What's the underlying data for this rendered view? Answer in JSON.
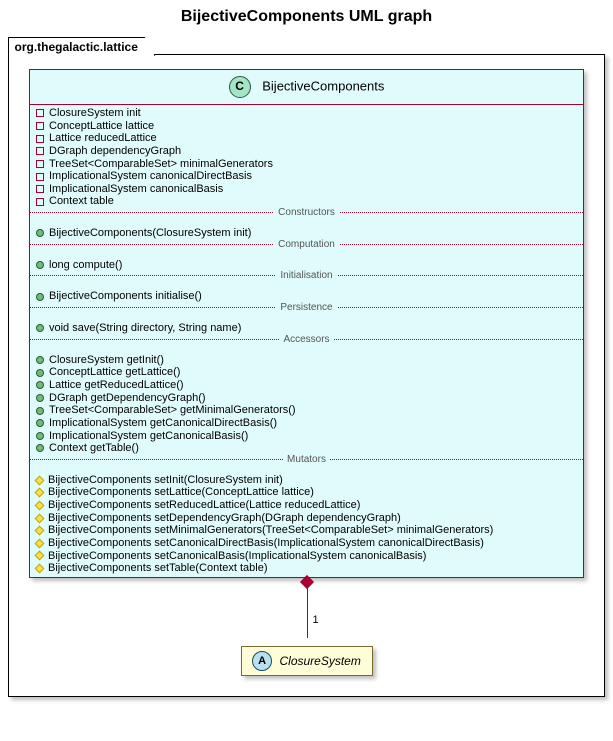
{
  "title": "BijectiveComponents UML graph",
  "package_name": "org.thegalactic.lattice",
  "class": {
    "marker": "C",
    "name": "BijectiveComponents",
    "fields": [
      "ClosureSystem init",
      "ConceptLattice lattice",
      "Lattice reducedLattice",
      "DGraph dependencyGraph",
      "TreeSet<ComparableSet> minimalGenerators",
      "ImplicationalSystem canonicalDirectBasis",
      "ImplicationalSystem canonicalBasis",
      "Context table"
    ],
    "sections": [
      {
        "label": "Constructors",
        "marker": "circle-green",
        "items": [
          "BijectiveComponents(ClosureSystem init)"
        ]
      },
      {
        "label": "Computation",
        "marker": "circle-green",
        "items": [
          "long compute()"
        ]
      },
      {
        "label": "Initialisation",
        "marker": "circle-green",
        "items": [
          "BijectiveComponents initialise()"
        ]
      },
      {
        "label": "Persistence",
        "marker": "circle-green",
        "items": [
          "void save(String directory, String name)"
        ]
      },
      {
        "label": "Accessors",
        "marker": "circle-green",
        "items": [
          "ClosureSystem getInit()",
          "ConceptLattice getLattice()",
          "Lattice getReducedLattice()",
          "DGraph getDependencyGraph()",
          "TreeSet<ComparableSet> getMinimalGenerators()",
          "ImplicationalSystem getCanonicalDirectBasis()",
          "ImplicationalSystem getCanonicalBasis()",
          "Context getTable()"
        ]
      },
      {
        "label": "Mutators",
        "marker": "diamond-yellow",
        "items": [
          "BijectiveComponents setInit(ClosureSystem init)",
          "BijectiveComponents setLattice(ConceptLattice lattice)",
          "BijectiveComponents setReducedLattice(Lattice reducedLattice)",
          "BijectiveComponents setDependencyGraph(DGraph dependencyGraph)",
          "BijectiveComponents setMinimalGenerators(TreeSet<ComparableSet> minimalGenerators)",
          "BijectiveComponents setCanonicalDirectBasis(ImplicationalSystem canonicalDirectBasis)",
          "BijectiveComponents setCanonicalBasis(ImplicationalSystem canonicalBasis)",
          "BijectiveComponents setTable(Context table)"
        ]
      }
    ]
  },
  "relation": {
    "multiplicity": "1",
    "target_marker": "A",
    "target_name": "ClosureSystem"
  }
}
